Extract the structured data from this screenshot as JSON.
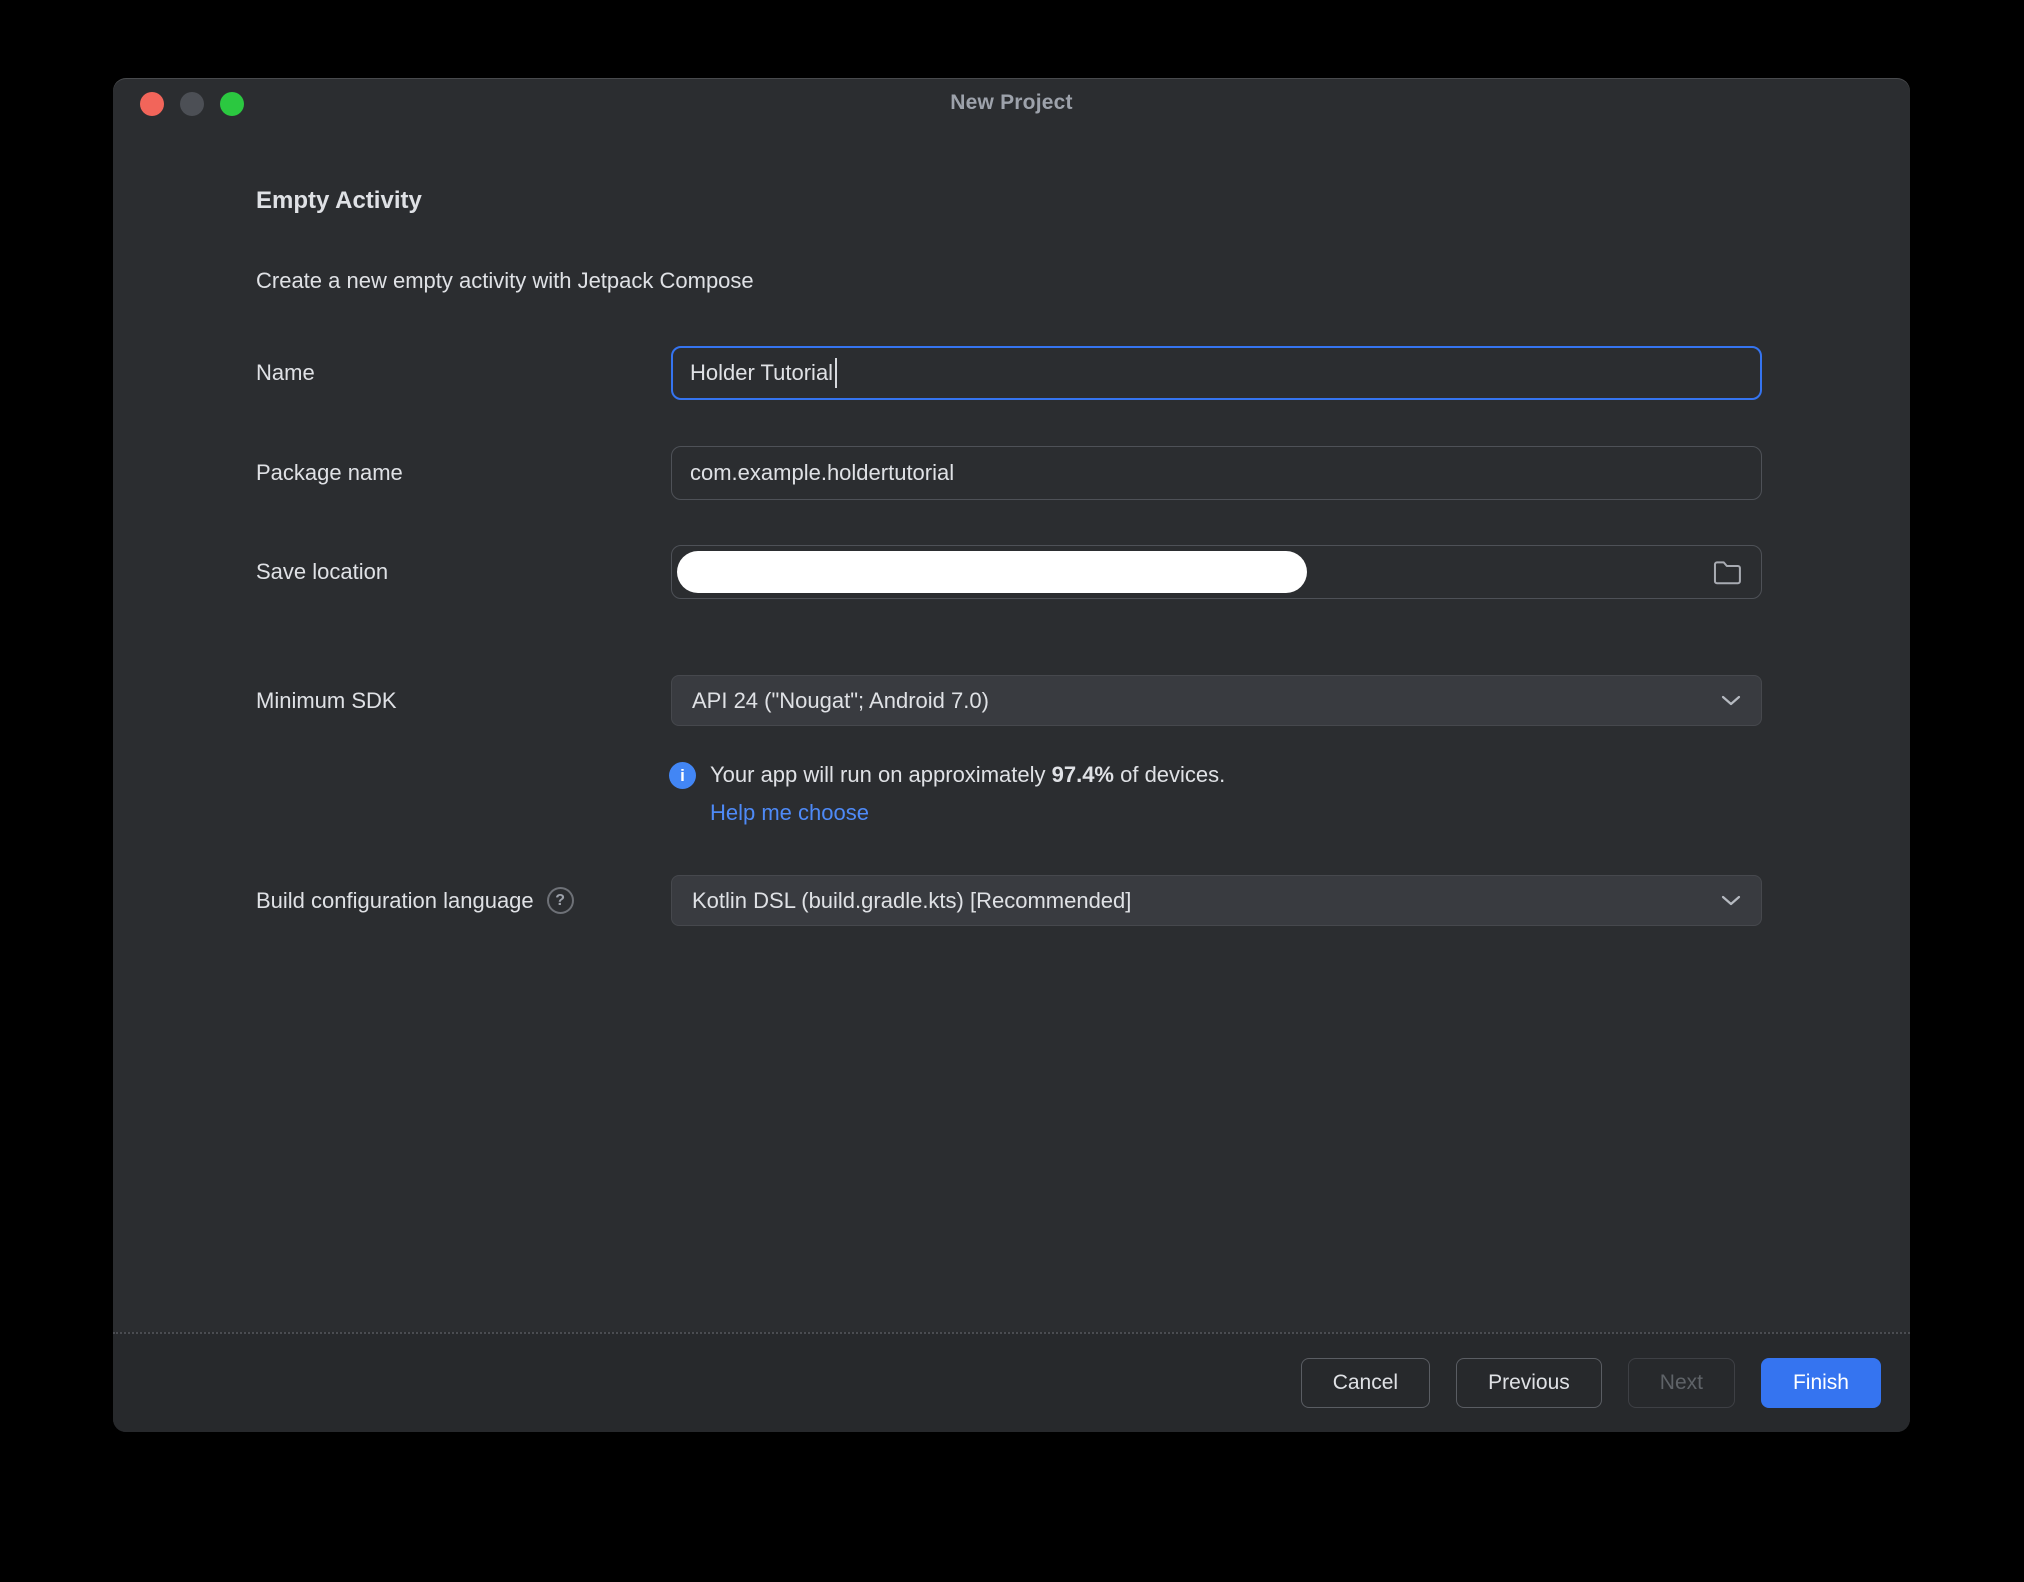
{
  "colors": {
    "accent": "#3574F0",
    "link": "#4E8AF7",
    "window-bg": "#2B2D30",
    "footer-bg": "#27292C",
    "field-border": "#4E5157",
    "dropdown-bg": "#393B40",
    "text": "#DFE1E5",
    "muted": "#9DA2AB",
    "traffic-close": "#F2655A",
    "traffic-minimize": "#4C4F55",
    "traffic-zoom": "#2BC840"
  },
  "window": {
    "title": "New Project"
  },
  "header": {
    "title": "Empty Activity",
    "subtitle": "Create a new empty activity with Jetpack Compose"
  },
  "form": {
    "name": {
      "label": "Name",
      "value": "Holder Tutorial"
    },
    "package_name": {
      "label": "Package name",
      "value": "com.example.holdertutorial"
    },
    "save_location": {
      "label": "Save location"
    },
    "minimum_sdk": {
      "label": "Minimum SDK",
      "value": "API 24 (\"Nougat\"; Android 7.0)"
    },
    "sdk_info": {
      "text_before": "Your app will run on approximately ",
      "percentage": "97.4%",
      "text_after": " of devices.",
      "link": "Help me choose"
    },
    "build_config": {
      "label": "Build configuration language",
      "help": "?",
      "value": "Kotlin DSL (build.gradle.kts) [Recommended]"
    },
    "info_icon_glyph": "i"
  },
  "footer": {
    "cancel": "Cancel",
    "previous": "Previous",
    "next": "Next",
    "finish": "Finish"
  }
}
